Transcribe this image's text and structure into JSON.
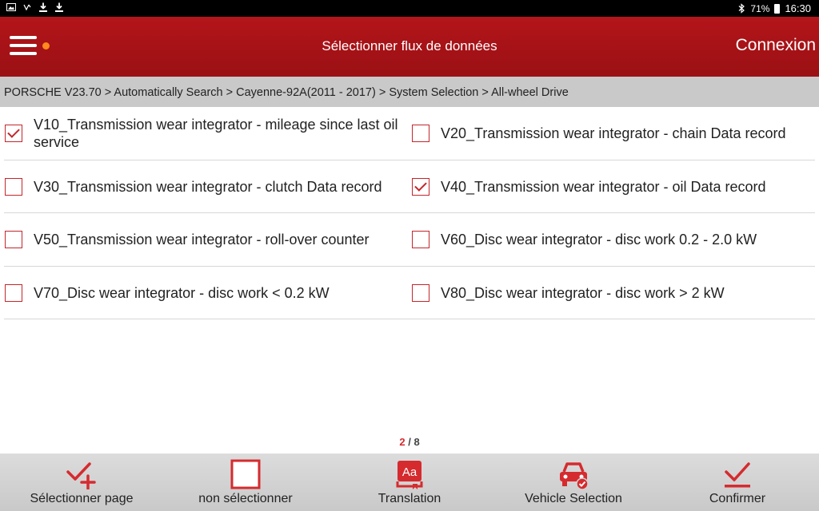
{
  "status_bar": {
    "battery": "71%",
    "time": "16:30"
  },
  "header": {
    "title": "Sélectionner flux de données",
    "connect_label": "Connexion"
  },
  "breadcrumb": "PORSCHE V23.70 > Automatically Search > Cayenne-92A(2011 - 2017) > System Selection > All-wheel Drive",
  "items": [
    {
      "label": "V10_Transmission wear integrator - mileage since last oil service",
      "checked": true
    },
    {
      "label": "V20_Transmission wear integrator - chain Data record",
      "checked": false
    },
    {
      "label": "V30_Transmission wear integrator - clutch Data record",
      "checked": false
    },
    {
      "label": "V40_Transmission wear integrator - oil Data record",
      "checked": true
    },
    {
      "label": "V50_Transmission wear integrator - roll-over counter",
      "checked": false
    },
    {
      "label": "V60_Disc wear integrator - disc work 0.2 - 2.0 kW",
      "checked": false
    },
    {
      "label": "V70_Disc wear integrator - disc work < 0.2 kW",
      "checked": false
    },
    {
      "label": "V80_Disc wear integrator - disc work > 2 kW",
      "checked": false
    }
  ],
  "pager": {
    "current": "2",
    "separator": "/",
    "total": "8"
  },
  "toolbar": {
    "select_page": "Sélectionner page",
    "deselect": "non sélectionner",
    "translation": "Translation",
    "translation_icon_text": "Aa",
    "vehicle_selection": "Vehicle Selection",
    "confirm": "Confirmer"
  },
  "colors": {
    "header_red": "#b3151a",
    "accent_red": "#d52b2f",
    "toolbar_gray": "#d2d2d2",
    "breadcrumb_gray": "#c9c9c9"
  }
}
